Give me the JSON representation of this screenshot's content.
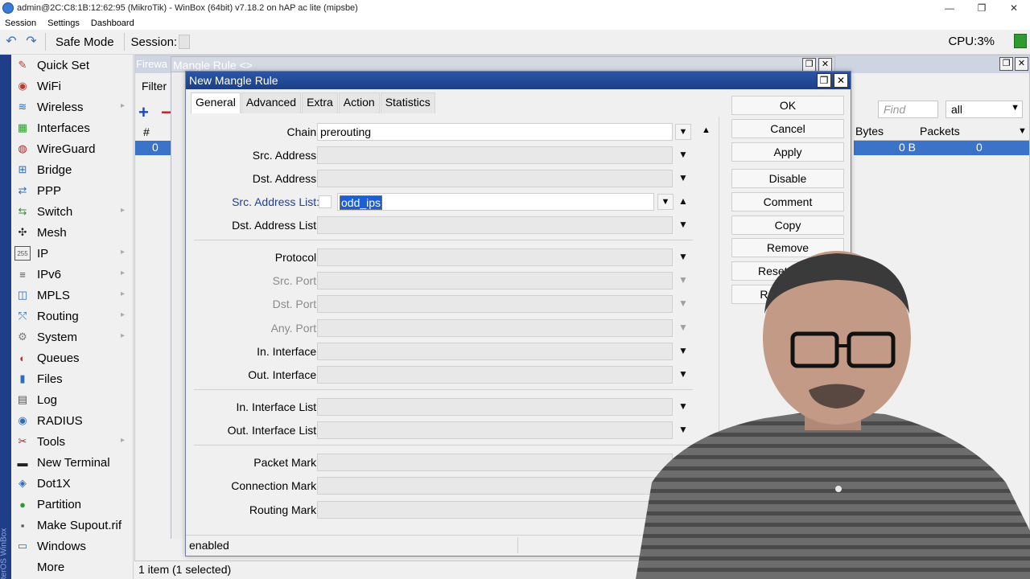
{
  "window": {
    "title": "admin@2C:C8:1B:12:62:95 (MikroTik) - WinBox (64bit) v7.18.2 on hAP ac lite (mipsbe)",
    "controls": [
      "—",
      "❐",
      "✕"
    ]
  },
  "menubar": [
    "Session",
    "Settings",
    "Dashboard"
  ],
  "toolbar": {
    "safe_mode": "Safe Mode",
    "session_label": "Session:",
    "cpu_label": "CPU:",
    "cpu_value": "3%"
  },
  "sidebar": {
    "vertical_text": "RouterOS WinBox",
    "items": [
      {
        "label": "Quick Set",
        "icon": "quickset-icon",
        "glyph": "✎",
        "color": "#c0392b",
        "submenu": false
      },
      {
        "label": "WiFi",
        "icon": "wifi-icon",
        "glyph": "◉",
        "color": "#c0392b",
        "submenu": false
      },
      {
        "label": "Wireless",
        "icon": "wireless-icon",
        "glyph": "≋",
        "color": "#2c6fb5",
        "submenu": true
      },
      {
        "label": "Interfaces",
        "icon": "interfaces-icon",
        "glyph": "▦",
        "color": "#2e9a2e",
        "submenu": false
      },
      {
        "label": "WireGuard",
        "icon": "wireguard-icon",
        "glyph": "◍",
        "color": "#b71c1c",
        "submenu": false
      },
      {
        "label": "Bridge",
        "icon": "bridge-icon",
        "glyph": "⊞",
        "color": "#2c6fb5",
        "submenu": false
      },
      {
        "label": "PPP",
        "icon": "ppp-icon",
        "glyph": "⇄",
        "color": "#2c6fb5",
        "submenu": false
      },
      {
        "label": "Switch",
        "icon": "switch-icon",
        "glyph": "⇆",
        "color": "#3a8a3a",
        "submenu": true
      },
      {
        "label": "Mesh",
        "icon": "mesh-icon",
        "glyph": "✣",
        "color": "#222",
        "submenu": false
      },
      {
        "label": "IP",
        "icon": "ip-icon",
        "glyph": "255",
        "color": "#555",
        "submenu": true
      },
      {
        "label": "IPv6",
        "icon": "ipv6-icon",
        "glyph": "≡",
        "color": "#555",
        "submenu": true
      },
      {
        "label": "MPLS",
        "icon": "mpls-icon",
        "glyph": "◫",
        "color": "#2c6fb5",
        "submenu": true
      },
      {
        "label": "Routing",
        "icon": "routing-icon",
        "glyph": "⤲",
        "color": "#2c6fb5",
        "submenu": true
      },
      {
        "label": "System",
        "icon": "system-icon",
        "glyph": "⚙",
        "color": "#777",
        "submenu": true
      },
      {
        "label": "Queues",
        "icon": "queues-icon",
        "glyph": "◐",
        "color": "#c0392b",
        "submenu": false
      },
      {
        "label": "Files",
        "icon": "files-icon",
        "glyph": "▮",
        "color": "#2c6fb5",
        "submenu": false
      },
      {
        "label": "Log",
        "icon": "log-icon",
        "glyph": "▤",
        "color": "#555",
        "submenu": false
      },
      {
        "label": "RADIUS",
        "icon": "radius-icon",
        "glyph": "◉",
        "color": "#2c6fb5",
        "submenu": false
      },
      {
        "label": "Tools",
        "icon": "tools-icon",
        "glyph": "✂",
        "color": "#b71c1c",
        "submenu": true
      },
      {
        "label": "New Terminal",
        "icon": "terminal-icon",
        "glyph": "▬",
        "color": "#222",
        "submenu": false
      },
      {
        "label": "Dot1X",
        "icon": "dot1x-icon",
        "glyph": "◈",
        "color": "#2c6fb5",
        "submenu": false
      },
      {
        "label": "Partition",
        "icon": "partition-icon",
        "glyph": "●",
        "color": "#2e9a2e",
        "submenu": false
      },
      {
        "label": "Make Supout.rif",
        "icon": "supout-icon",
        "glyph": "▪",
        "color": "#555",
        "submenu": false
      },
      {
        "label": "Windows",
        "icon": "windows-icon",
        "glyph": "▭",
        "color": "#2c6fb5",
        "submenu": false
      },
      {
        "label": "More",
        "icon": "",
        "glyph": "",
        "color": "#000",
        "submenu": false
      }
    ]
  },
  "firewall": {
    "title": "Firewa",
    "filter_tab": "Filter",
    "hash": "#",
    "row_index": "0",
    "find_placeholder": "Find",
    "filter_value": "all",
    "col_bytes": "Bytes",
    "col_packets": "Packets",
    "bytes_value": "0 B",
    "packets_value": "0",
    "status_left": "1 item (1 selected)",
    "enabled_partial": "en"
  },
  "mangle_title_bg": "Mangle Rule <>",
  "dialog": {
    "title": "New Mangle Rule",
    "tabs": [
      "General",
      "Advanced",
      "Extra",
      "Action",
      "Statistics"
    ],
    "active_tab": "General",
    "fields": {
      "chain": {
        "label": "Chain:",
        "value": "prerouting"
      },
      "src_address": {
        "label": "Src. Address:",
        "value": ""
      },
      "dst_address": {
        "label": "Dst. Address:",
        "value": ""
      },
      "src_address_list": {
        "label": "Src. Address List:",
        "value": "odd_ips"
      },
      "dst_address_list": {
        "label": "Dst. Address List:",
        "value": ""
      },
      "protocol": {
        "label": "Protocol:",
        "value": ""
      },
      "src_port": {
        "label": "Src. Port:",
        "value": ""
      },
      "dst_port": {
        "label": "Dst. Port:",
        "value": ""
      },
      "any_port": {
        "label": "Any. Port:",
        "value": ""
      },
      "in_interface": {
        "label": "In. Interface:",
        "value": ""
      },
      "out_interface": {
        "label": "Out. Interface:",
        "value": ""
      },
      "in_interface_list": {
        "label": "In. Interface List:",
        "value": ""
      },
      "out_interface_list": {
        "label": "Out. Interface List:",
        "value": ""
      },
      "packet_mark": {
        "label": "Packet Mark:",
        "value": ""
      },
      "connection_mark": {
        "label": "Connection Mark:",
        "value": ""
      },
      "routing_mark": {
        "label": "Routing Mark:",
        "value": ""
      }
    },
    "buttons": {
      "ok": "OK",
      "cancel": "Cancel",
      "apply": "Apply",
      "disable": "Disable",
      "comment": "Comment",
      "copy": "Copy",
      "remove": "Remove",
      "reset_counters": "Reset Coun",
      "reset_all_counters": "Reset All C"
    },
    "status": "enabled"
  },
  "colors": {
    "accent": "#1d3f86",
    "selection": "#3b73c8",
    "sidebar_strip": "#1f3e87",
    "cpu_indicator": "#2f9a2f"
  }
}
